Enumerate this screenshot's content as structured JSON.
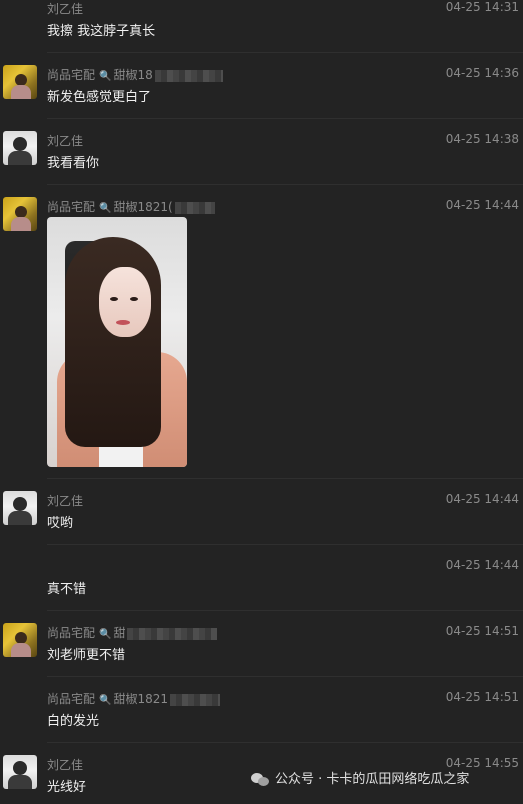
{
  "messages": [
    {
      "sender": "刘乙佳",
      "time": "04-25 14:31",
      "text": "我擦 我这脖子真长"
    },
    {
      "sender": "尚品宅配",
      "sender_extra": "甜椒18",
      "time": "04-25 14:36",
      "text": "新发色感觉更白了"
    },
    {
      "sender": "刘乙佳",
      "time": "04-25 14:38",
      "text": "我看看你"
    },
    {
      "sender": "尚品宅配",
      "sender_extra": "甜椒1821(",
      "time": "04-25 14:44",
      "text": ""
    },
    {
      "sender": "刘乙佳",
      "time": "04-25 14:44",
      "text": "哎哟"
    },
    {
      "sender": "",
      "time": "04-25 14:44",
      "text": "真不错"
    },
    {
      "sender": "尚品宅配",
      "sender_extra": "甜",
      "time": "04-25 14:51",
      "text": "刘老师更不错"
    },
    {
      "sender": "尚品宅配",
      "sender_extra": "甜椒1821",
      "time": "04-25 14:51",
      "text": "白的发光"
    },
    {
      "sender": "刘乙佳",
      "time": "04-25 14:55",
      "text": "光线好"
    }
  ],
  "watermark": {
    "text": "公众号 · 卡卡的瓜田网络吃瓜之家"
  },
  "icons": {
    "magnifier": "🔍"
  }
}
